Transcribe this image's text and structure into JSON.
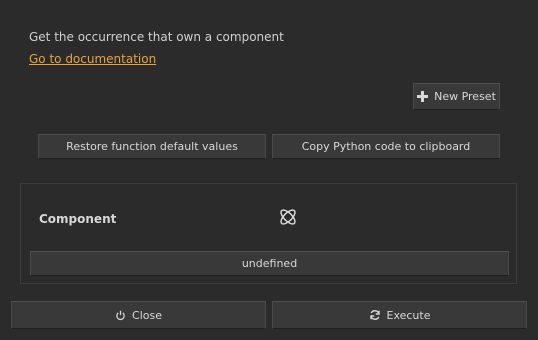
{
  "description": "Get the occurrence that own a component",
  "doc_link": "Go to documentation",
  "buttons": {
    "new_preset": "New Preset",
    "restore_defaults": "Restore function default values",
    "copy_python": "Copy Python code to clipboard",
    "close": "Close",
    "execute": "Execute"
  },
  "parameter": {
    "label": "Component",
    "value": "undefined",
    "icon": "component-icon"
  },
  "colors": {
    "background": "#2b2b2b",
    "link": "#e8a33d",
    "button": "#393939"
  }
}
